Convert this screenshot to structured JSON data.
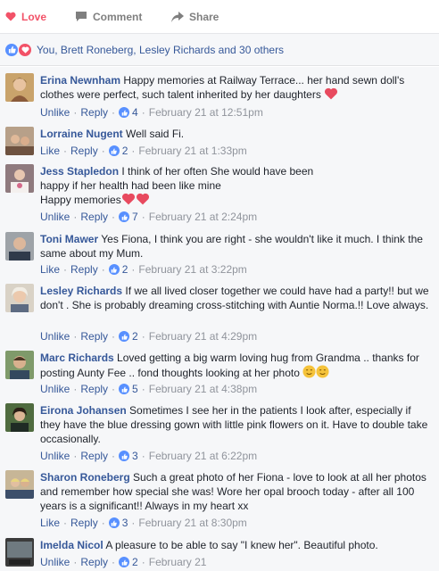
{
  "actions": {
    "love_label": "Love",
    "comment_label": "Comment",
    "share_label": "Share"
  },
  "reactions": {
    "summary": "You, Brett Roneberg, Lesley Richards and 30 others"
  },
  "comments": [
    {
      "author": "Erina Newnham",
      "text": "Happy memories at Railway Terrace... her hand sewn doll's clothes were perfect, such talent inherited by her daughters",
      "action": "Unlike",
      "reply": "Reply",
      "likes": "4",
      "time": "February 21 at 12:51pm"
    },
    {
      "author": "Lorraine Nugent",
      "text": "Well said Fi.",
      "action": "Like",
      "reply": "Reply",
      "likes": "2",
      "time": "February 21 at 1:33pm"
    },
    {
      "author": "Jess Stapledon",
      "text": "I think of her often She would have been",
      "text2": "happy if her health had been like mine",
      "text3": "Happy memories",
      "action": "Unlike",
      "reply": "Reply",
      "likes": "7",
      "time": "February 21 at 2:24pm"
    },
    {
      "author": "Toni Mawer",
      "text": "Yes Fiona, I think you are right - she wouldn't like it much. I think the same about my Mum.",
      "action": "Like",
      "reply": "Reply",
      "likes": "2",
      "time": "February 21 at 3:22pm"
    },
    {
      "author": "Lesley Richards",
      "text": "If we all lived closer together we could have had a party!! but we don't . She is probably dreaming cross-stitching with Auntie Norma.!! Love always.",
      "action": "Unlike",
      "reply": "Reply",
      "likes": "2",
      "time": "February 21 at 4:29pm"
    },
    {
      "author": "Marc Richards",
      "text": "Loved getting a big warm loving hug from Grandma .. thanks for posting Aunty Fee .. fond thoughts looking at her photo",
      "action": "Unlike",
      "reply": "Reply",
      "likes": "5",
      "time": "February 21 at 4:38pm"
    },
    {
      "author": "Eirona Johansen",
      "text": "Sometimes I see her in the patients I look after, especially if they have the blue dressing gown with little pink flowers on it. Have to double take occasionally.",
      "action": "Unlike",
      "reply": "Reply",
      "likes": "3",
      "time": "February 21 at 6:22pm"
    },
    {
      "author": "Sharon Roneberg",
      "text": "Such a great photo of her Fiona - love to look at all her photos and remember how special she was! Wore her opal brooch today - after all 100 years is a significant!! Always in my heart xx",
      "action": "Like",
      "reply": "Reply",
      "likes": "3",
      "time": "February 21 at 8:30pm"
    },
    {
      "author": "Imelda Nicol",
      "text": "A pleasure to be able to say \"I knew her\". Beautiful photo.",
      "action": "Unlike",
      "reply": "Reply",
      "likes": "2",
      "time": "February 21"
    }
  ],
  "colors": {
    "love": "#f25268",
    "link": "#365899",
    "like_blue": "#5890ff",
    "meta_gray": "#90949c"
  }
}
